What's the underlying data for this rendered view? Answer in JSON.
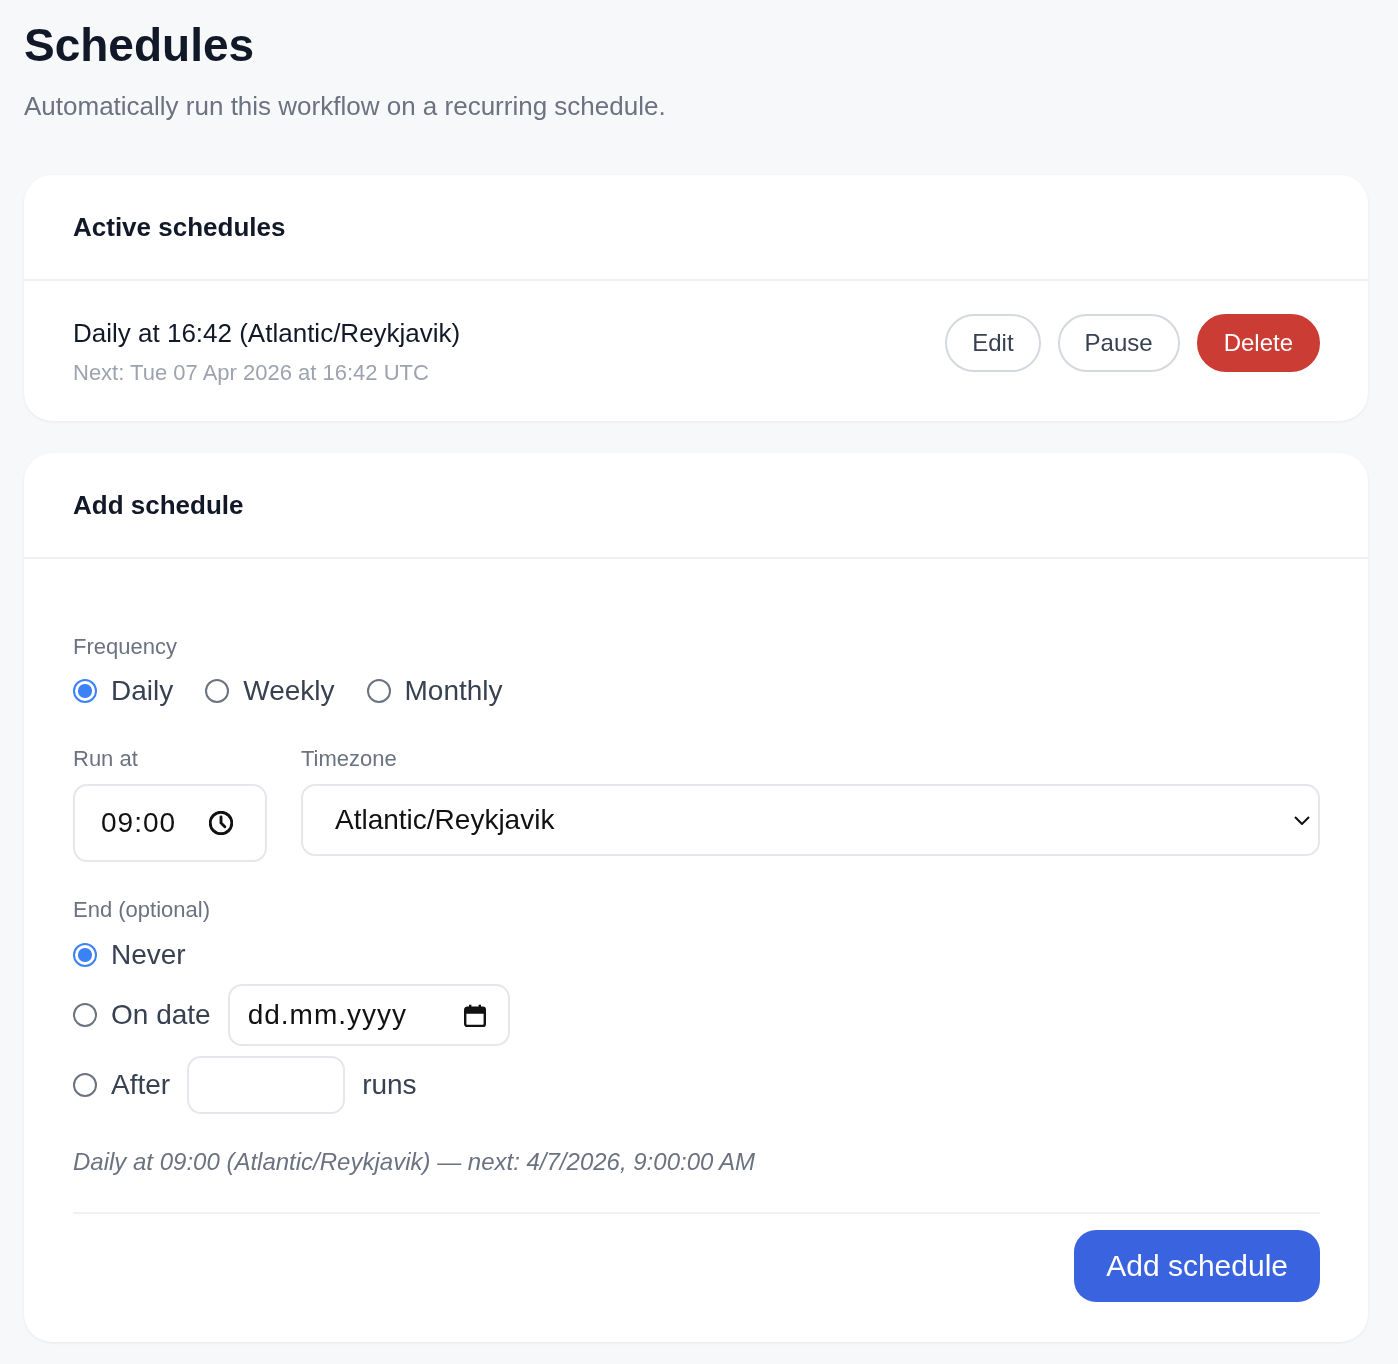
{
  "page": {
    "title": "Schedules",
    "subtitle": "Automatically run this workflow on a recurring schedule."
  },
  "active_schedules": {
    "title": "Active schedules",
    "items": [
      {
        "name": "Daily at 16:42 (Atlantic/Reykjavik)",
        "next": "Next: Tue 07 Apr 2026 at 16:42 UTC",
        "actions": [
          {
            "label": "Edit",
            "kind": "outline"
          },
          {
            "label": "Pause",
            "kind": "outline"
          },
          {
            "label": "Delete",
            "kind": "danger"
          }
        ]
      }
    ]
  },
  "add_schedule": {
    "title": "Add schedule",
    "frequency": {
      "label": "Frequency",
      "options": [
        {
          "label": "Daily",
          "selected": true
        },
        {
          "label": "Weekly",
          "selected": false
        },
        {
          "label": "Monthly",
          "selected": false
        }
      ]
    },
    "run_at": {
      "label": "Run at",
      "value": "09:00"
    },
    "timezone": {
      "label": "Timezone",
      "value": "Atlantic/Reykjavik"
    },
    "end": {
      "label": "End (optional)",
      "options": [
        {
          "kind": "plain",
          "label": "Never",
          "selected": true
        },
        {
          "kind": "date",
          "label": "On date",
          "selected": false,
          "placeholder": "dd.mm.yyyy"
        },
        {
          "kind": "count",
          "label": "After",
          "selected": false,
          "suffix": "runs"
        }
      ]
    },
    "summary": "Daily at 09:00 (Atlantic/Reykjavik) — next: 4/7/2026, 9:00:00 AM",
    "submit": "Add schedule"
  }
}
